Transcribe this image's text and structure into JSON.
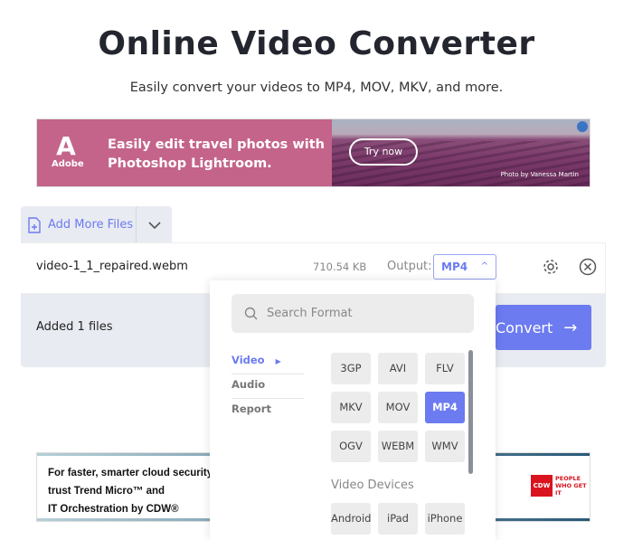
{
  "header": {
    "title": "Online Video Converter",
    "subtitle": "Easily convert your videos to MP4, MOV, MKV, and more."
  },
  "ad_top": {
    "brand": "Adobe",
    "headline_1": "Easily edit travel photos with",
    "headline_2": "Photoshop Lightroom.",
    "cta": "Try now",
    "credit": "Photo by Vanessa Martin",
    "color": "#c4648a"
  },
  "toolbar": {
    "add_files": "Add More Files"
  },
  "file": {
    "name": "video-1_1_repaired.webm",
    "size": "710.54 KB",
    "output_label": "Output:",
    "output_value": "MP4"
  },
  "footer": {
    "added": "Added 1 files",
    "convert": "Convert"
  },
  "dropdown": {
    "search_placeholder": "Search Format",
    "categories": [
      {
        "label": "Video",
        "active": true
      },
      {
        "label": "Audio"
      },
      {
        "label": "Report"
      }
    ],
    "formats": [
      "3GP",
      "AVI",
      "FLV",
      "MKV",
      "MOV",
      "MP4",
      "OGV",
      "WEBM",
      "WMV"
    ],
    "selected": "MP4",
    "devices_header": "Video Devices",
    "devices": [
      "Android",
      "iPad",
      "iPhone"
    ]
  },
  "ad_bottom": {
    "line_1": "For faster, smarter cloud security,",
    "line_2": "trust Trend Micro™ and",
    "line_3": "IT Orchestration by CDW®",
    "brand": "CDW",
    "tagline": "PEOPLE WHO GET IT"
  },
  "colors": {
    "accent": "#6c7bf0",
    "panel": "#e9ebf2"
  }
}
